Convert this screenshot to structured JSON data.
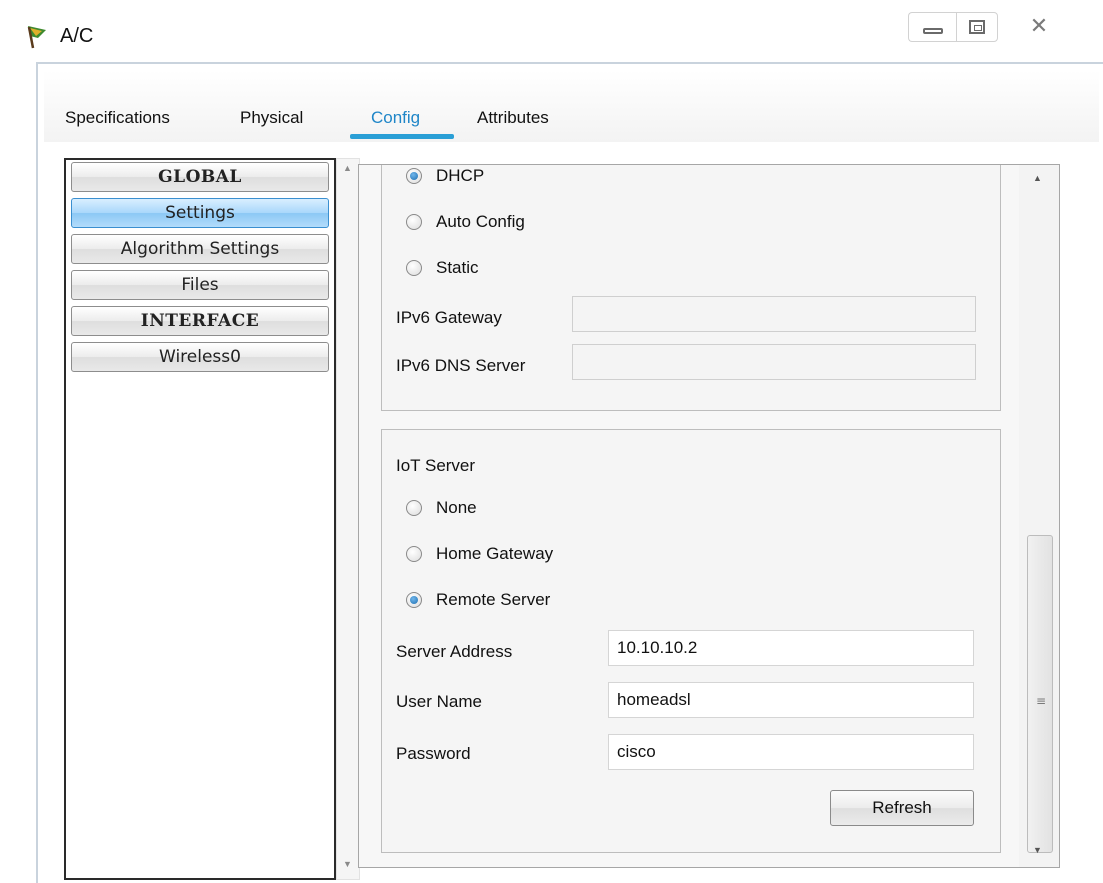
{
  "window": {
    "title": "A/C"
  },
  "tabs": [
    {
      "label": "Specifications"
    },
    {
      "label": "Physical"
    },
    {
      "label": "Config"
    },
    {
      "label": "Attributes"
    }
  ],
  "active_tab": "Config",
  "sidebar": {
    "items": [
      {
        "label": "GLOBAL",
        "type": "header"
      },
      {
        "label": "Settings",
        "type": "item",
        "selected": true
      },
      {
        "label": "Algorithm Settings",
        "type": "item"
      },
      {
        "label": "Files",
        "type": "item"
      },
      {
        "label": "INTERFACE",
        "type": "header"
      },
      {
        "label": "Wireless0",
        "type": "item"
      }
    ]
  },
  "ipv6_section": {
    "options": [
      {
        "label": "DHCP",
        "checked": true
      },
      {
        "label": "Auto Config",
        "checked": false
      },
      {
        "label": "Static",
        "checked": false
      }
    ],
    "gateway_label": "IPv6 Gateway",
    "gateway_value": "",
    "dns_label": "IPv6 DNS Server",
    "dns_value": ""
  },
  "iot_section": {
    "title": "IoT Server",
    "options": [
      {
        "label": "None",
        "checked": false
      },
      {
        "label": "Home Gateway",
        "checked": false
      },
      {
        "label": "Remote Server",
        "checked": true
      }
    ],
    "server_address_label": "Server Address",
    "server_address_value": "10.10.10.2",
    "user_name_label": "User Name",
    "user_name_value": "homeadsl",
    "password_label": "Password",
    "password_value": "cisco",
    "refresh_label": "Refresh"
  },
  "colors": {
    "accent": "#2a9fd6",
    "active_tab_text": "#1f86c8",
    "selected_item": "#8cc8f5"
  }
}
